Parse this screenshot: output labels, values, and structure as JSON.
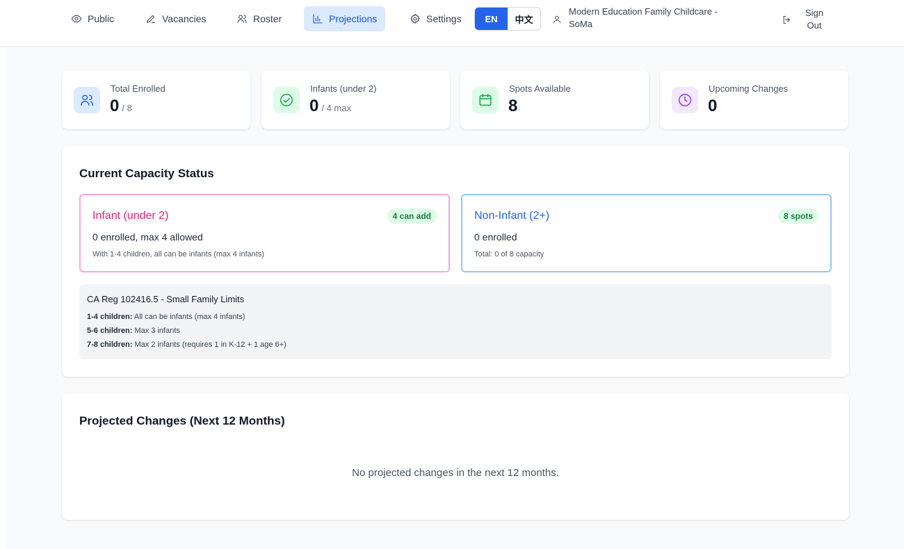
{
  "nav": {
    "items": [
      {
        "label": "Public",
        "icon": "eye-icon"
      },
      {
        "label": "Vacancies",
        "icon": "pencil-icon"
      },
      {
        "label": "Roster",
        "icon": "users-icon"
      },
      {
        "label": "Projections",
        "icon": "bar-chart-icon",
        "active": true
      },
      {
        "label": "Settings",
        "icon": "gear-icon"
      }
    ],
    "lang_en": "EN",
    "lang_zh": "中文",
    "user_line1": "Modern Education Family Childcare -",
    "user_line2": "SoMa",
    "signout_line1": "Sign",
    "signout_line2": "Out"
  },
  "stats": [
    {
      "label": "Total Enrolled",
      "value": "0",
      "sub": "/ 8",
      "icon": "users-icon",
      "color": "#2563eb",
      "bg": "#dbeafe"
    },
    {
      "label": "Infants (under 2)",
      "value": "0",
      "sub": "/ 4 max",
      "icon": "check-circle-icon",
      "color": "#16a34a",
      "bg": "#dcfce7"
    },
    {
      "label": "Spots Available",
      "value": "8",
      "sub": "",
      "icon": "calendar-icon",
      "color": "#16a34a",
      "bg": "#dcfce7"
    },
    {
      "label": "Upcoming Changes",
      "value": "0",
      "sub": "",
      "icon": "clock-icon",
      "color": "#9333ea",
      "bg": "#f3e8ff"
    }
  ],
  "capacity": {
    "title": "Current Capacity Status",
    "infant": {
      "title": "Infant (under 2)",
      "badge": "4 can add",
      "line1": "0 enrolled, max 4 allowed",
      "line2": "With 1-4 children, all can be infants (max 4 infants)",
      "color": "#db2777",
      "border": "#f9a8d4"
    },
    "noninfant": {
      "title": "Non-Infant (2+)",
      "badge": "8 spots",
      "line1": "0 enrolled",
      "line2": "Total: 0 of 8 capacity",
      "color": "#2563eb",
      "border": "#93c5fd"
    },
    "reg": {
      "title": "CA Reg 102416.5 - Small Family Limits",
      "lines": [
        {
          "bold": "1-4 children:",
          "text": " All can be infants (max 4 infants)"
        },
        {
          "bold": "5-6 children:",
          "text": " Max 3 infants"
        },
        {
          "bold": "7-8 children:",
          "text": " Max 2 infants (requires 1 in K-12 + 1 age 6+)"
        }
      ]
    }
  },
  "projected": {
    "title": "Projected Changes (Next 12 Months)",
    "empty": "No projected changes in the next 12 months."
  }
}
